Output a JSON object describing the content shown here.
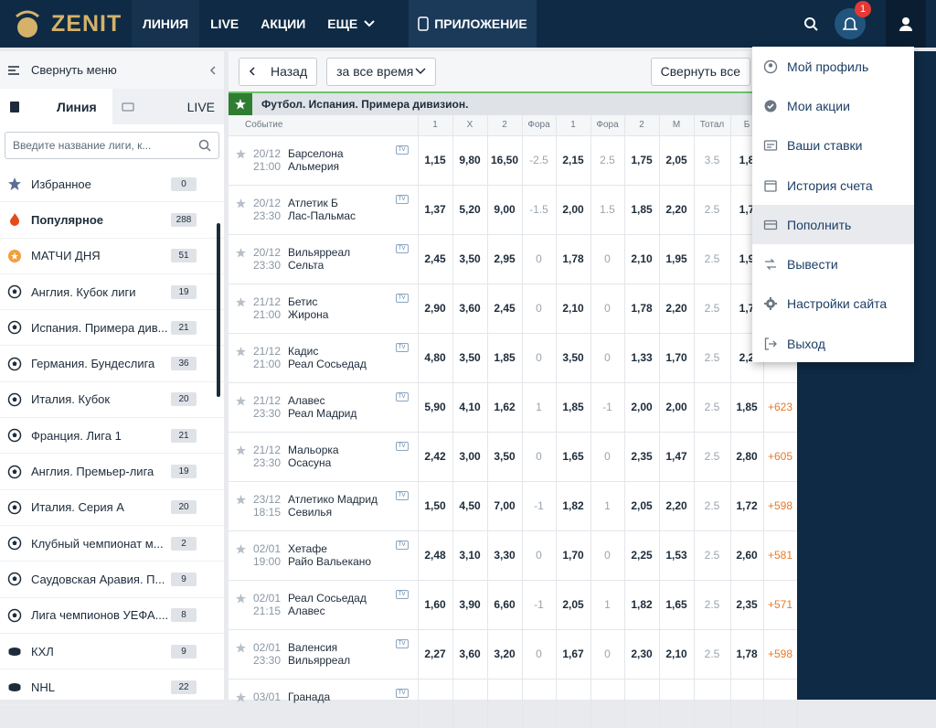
{
  "brand": {
    "name": "ZENIT"
  },
  "nav": {
    "items": [
      "ЛИНИЯ",
      "LIVE",
      "АКЦИИ",
      "ЕЩЕ"
    ],
    "app": "ПРИЛОЖЕНИЕ",
    "notifications": "1"
  },
  "sidebar": {
    "collapse": "Свернуть меню",
    "tab_line": "Линия",
    "tab_live": "LIVE",
    "search_placeholder": "Введите название лиги, к...",
    "items": [
      {
        "label": "Избранное",
        "count": "0",
        "icon": "star-icon"
      },
      {
        "label": "Популярное",
        "count": "288",
        "icon": "fire-icon"
      },
      {
        "label": "МАТЧИ ДНЯ",
        "count": "51",
        "icon": "star-badge-icon"
      },
      {
        "label": "Англия. Кубок лиги",
        "count": "19",
        "icon": "soccer-ball-icon"
      },
      {
        "label": "Испания. Примера див...",
        "count": "21",
        "icon": "soccer-ball-icon"
      },
      {
        "label": "Германия. Бундеслига",
        "count": "36",
        "icon": "soccer-ball-icon"
      },
      {
        "label": "Италия. Кубок",
        "count": "20",
        "icon": "soccer-ball-icon"
      },
      {
        "label": "Франция. Лига 1",
        "count": "21",
        "icon": "soccer-ball-icon"
      },
      {
        "label": "Англия. Премьер-лига",
        "count": "19",
        "icon": "soccer-ball-icon"
      },
      {
        "label": "Италия. Серия А",
        "count": "20",
        "icon": "soccer-ball-icon"
      },
      {
        "label": "Клубный чемпионат м...",
        "count": "2",
        "icon": "soccer-ball-icon"
      },
      {
        "label": "Саудовская Аравия. П...",
        "count": "9",
        "icon": "soccer-ball-icon"
      },
      {
        "label": "Лига чемпионов УЕФА....",
        "count": "8",
        "icon": "soccer-ball-icon"
      },
      {
        "label": "КХЛ",
        "count": "9",
        "icon": "hockey-puck-icon"
      },
      {
        "label": "NHL",
        "count": "22",
        "icon": "hockey-puck-icon"
      }
    ]
  },
  "main": {
    "back": "Назад",
    "period": "за все время",
    "collapse_all": "Свернуть все",
    "league": "Футбол. Испания. Примера дивизион.",
    "headers": [
      "Событие",
      "1",
      "X",
      "2",
      "Фора",
      "1",
      "Фора",
      "2",
      "М",
      "Тотал",
      "Б",
      ""
    ],
    "rows": [
      {
        "date": "20/12",
        "time": "21:00",
        "home": "Барселона",
        "away": "Альмерия",
        "o": [
          "1,15",
          "9,80",
          "16,50",
          "-2.5",
          "2,15",
          "2.5",
          "1,75",
          "2,05",
          "3.5",
          "1,8",
          ""
        ]
      },
      {
        "date": "20/12",
        "time": "23:30",
        "home": "Атлетик Б",
        "away": "Лас-Пальмас",
        "o": [
          "1,37",
          "5,20",
          "9,00",
          "-1.5",
          "2,00",
          "1.5",
          "1,85",
          "2,20",
          "2.5",
          "1,7",
          ""
        ]
      },
      {
        "date": "20/12",
        "time": "23:30",
        "home": "Вильярреал",
        "away": "Сельта",
        "o": [
          "2,45",
          "3,50",
          "2,95",
          "0",
          "1,78",
          "0",
          "2,10",
          "1,95",
          "2.5",
          "1,9",
          ""
        ]
      },
      {
        "date": "21/12",
        "time": "21:00",
        "home": "Бетис",
        "away": "Жирона",
        "o": [
          "2,90",
          "3,60",
          "2,45",
          "0",
          "2,10",
          "0",
          "1,78",
          "2,20",
          "2.5",
          "1,7",
          ""
        ]
      },
      {
        "date": "21/12",
        "time": "21:00",
        "home": "Кадис",
        "away": "Реал Сосьедад",
        "o": [
          "4,80",
          "3,50",
          "1,85",
          "0",
          "3,50",
          "0",
          "1,33",
          "1,70",
          "2.5",
          "2,2",
          ""
        ]
      },
      {
        "date": "21/12",
        "time": "23:30",
        "home": "Алавес",
        "away": "Реал Мадрид",
        "o": [
          "5,90",
          "4,10",
          "1,62",
          "1",
          "1,85",
          "-1",
          "2,00",
          "2,00",
          "2.5",
          "1,85",
          "+623"
        ]
      },
      {
        "date": "21/12",
        "time": "23:30",
        "home": "Мальорка",
        "away": "Осасуна",
        "o": [
          "2,42",
          "3,00",
          "3,50",
          "0",
          "1,65",
          "0",
          "2,35",
          "1,47",
          "2.5",
          "2,80",
          "+605"
        ]
      },
      {
        "date": "23/12",
        "time": "18:15",
        "home": "Атлетико Мадрид",
        "away": "Севилья",
        "o": [
          "1,50",
          "4,50",
          "7,00",
          "-1",
          "1,82",
          "1",
          "2,05",
          "2,20",
          "2.5",
          "1,72",
          "+598"
        ]
      },
      {
        "date": "02/01",
        "time": "19:00",
        "home": "Хетафе",
        "away": "Райо Вальекано",
        "o": [
          "2,48",
          "3,10",
          "3,30",
          "0",
          "1,70",
          "0",
          "2,25",
          "1,53",
          "2.5",
          "2,60",
          "+581"
        ]
      },
      {
        "date": "02/01",
        "time": "21:15",
        "home": "Реал Сосьедад",
        "away": "Алавес",
        "o": [
          "1,60",
          "3,90",
          "6,60",
          "-1",
          "2,05",
          "1",
          "1,82",
          "1,65",
          "2.5",
          "2,35",
          "+571"
        ]
      },
      {
        "date": "02/01",
        "time": "23:30",
        "home": "Валенсия",
        "away": "Вильярреал",
        "o": [
          "2,27",
          "3,60",
          "3,20",
          "0",
          "1,67",
          "0",
          "2,30",
          "2,10",
          "2.5",
          "1,78",
          "+598"
        ]
      },
      {
        "date": "03/01",
        "time": "",
        "home": "Гранада",
        "away": "",
        "o": [
          "",
          "",
          "",
          "",
          "",
          "",
          "",
          "",
          "",
          "",
          ""
        ]
      }
    ]
  },
  "menu": {
    "items": [
      {
        "label": "Мой профиль",
        "icon": "profile-icon"
      },
      {
        "label": "Мои акции",
        "icon": "check-circle-icon"
      },
      {
        "label": "Ваши ставки",
        "icon": "bets-icon"
      },
      {
        "label": "История счета",
        "icon": "calendar-icon"
      },
      {
        "label": "Пополнить",
        "icon": "card-icon"
      },
      {
        "label": "Вывести",
        "icon": "withdraw-icon"
      },
      {
        "label": "Настройки сайта",
        "icon": "gear-icon"
      },
      {
        "label": "Выход",
        "icon": "logout-icon"
      }
    ]
  }
}
